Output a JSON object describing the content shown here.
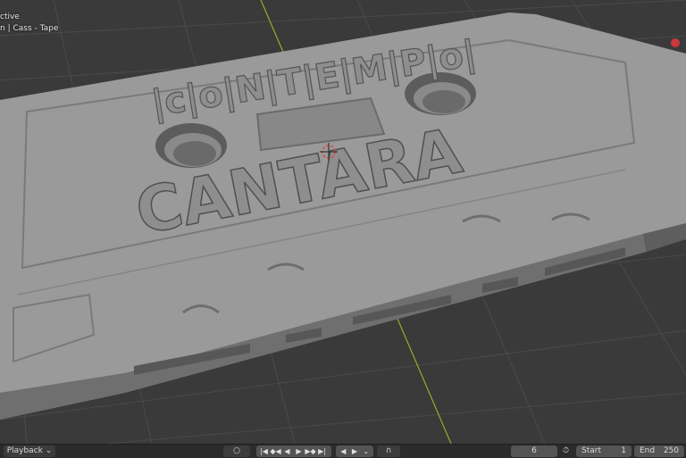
{
  "viewport": {
    "mode_text": "ctive",
    "object_text": "n | Cass - Tape"
  },
  "model": {
    "brand_text": "|c|o|N|T|E|M|P|o|",
    "label_text": "CANTARA"
  },
  "icons": {
    "snap": "circle-icon",
    "dropdown": "chevron-down-icon",
    "jump_start": "jump-to-start-icon",
    "prev_key": "previous-keyframe-icon",
    "play_reverse": "play-reverse-icon",
    "play": "play-icon",
    "next_key": "next-keyframe-icon",
    "jump_end": "jump-to-end-icon",
    "auto_key": "record-icon",
    "clock": "stopwatch-icon",
    "magnet": "magnet-icon"
  },
  "timeline": {
    "playback_label": "Playback",
    "dropdown_glyph": "⌄",
    "current_frame": "6",
    "start_label": "Start",
    "start_value": "1",
    "end_label": "End",
    "end_value": "250"
  },
  "colors": {
    "viewport_bg": "#3a3a3a",
    "grid": "#4a4a4a",
    "x_axis": "#c0393b",
    "y_axis": "#8fae2a",
    "model": "#9a9a9a"
  }
}
